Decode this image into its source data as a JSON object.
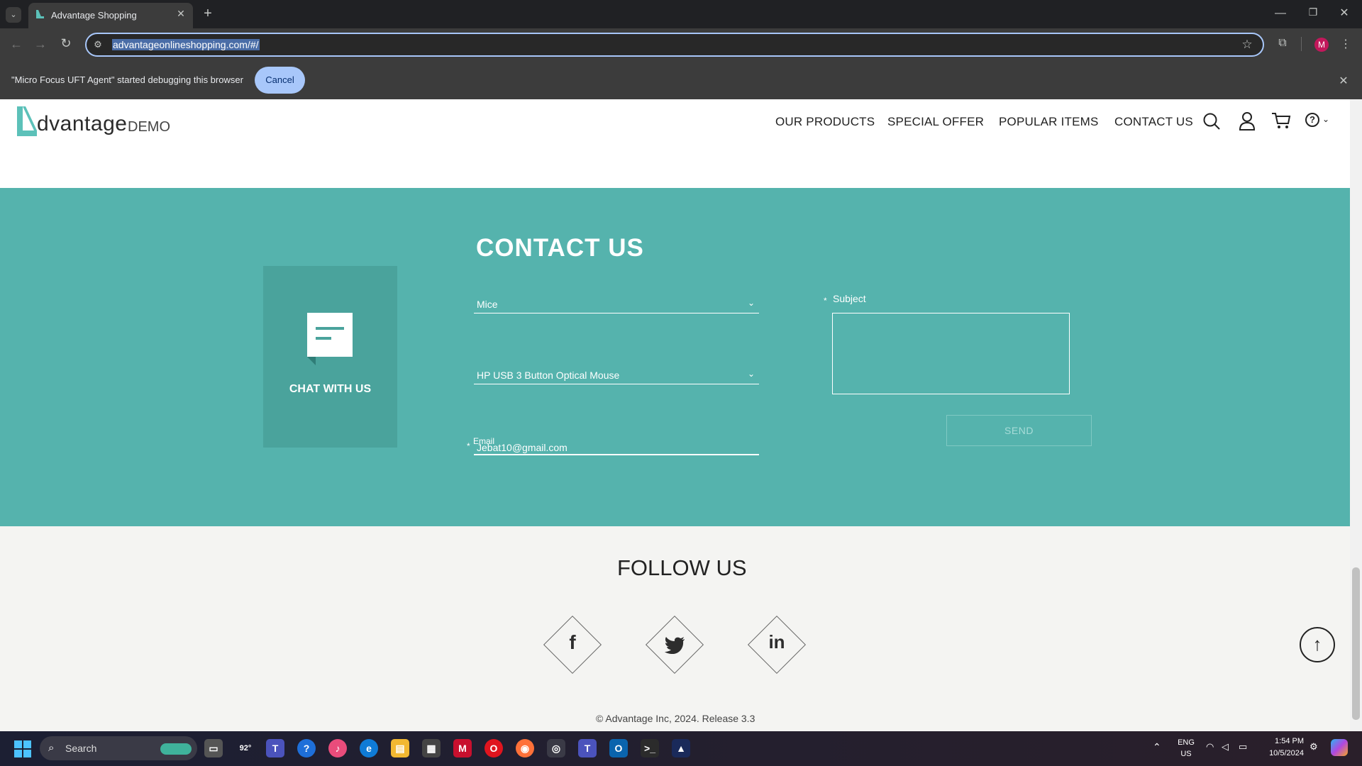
{
  "browser": {
    "tab_title": "Advantage Shopping",
    "url": "advantageonlineshopping.com/#/",
    "new_tab_icon": "+",
    "infobar_text": "\"Micro Focus UFT Agent\" started debugging this browser",
    "infobar_button": "Cancel",
    "profile_initial": "M"
  },
  "site": {
    "logo_main": "dvantage",
    "logo_demo": "DEMO",
    "nav": [
      "OUR PRODUCTS",
      "SPECIAL OFFER",
      "POPULAR ITEMS",
      "CONTACT US"
    ],
    "help_symbol": "?"
  },
  "contact": {
    "title": "CONTACT US",
    "chat_label": "CHAT WITH US",
    "category_value": "Mice",
    "product_value": "HP USB 3 Button Optical Mouse",
    "email_label": "Email",
    "email_value": "Jebat10@gmail.com",
    "subject_label": "Subject",
    "required_mark": "*",
    "send_label": "SEND"
  },
  "follow": {
    "title": "FOLLOW US",
    "facebook": "f",
    "linkedin": "in",
    "copyright": "© Advantage Inc, 2024. Release 3.3"
  },
  "taskbar": {
    "search_placeholder": "Search",
    "weather": "92°",
    "lang_line1": "ENG",
    "lang_line2": "US",
    "time": "1:54 PM",
    "date": "10/5/2024"
  },
  "colors": {
    "teal": "#55b3ad",
    "teal_dark": "#4aa39c",
    "accent": "#a8c7fa"
  }
}
